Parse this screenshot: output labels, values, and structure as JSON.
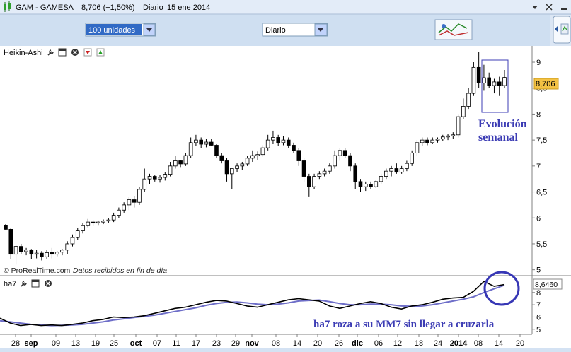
{
  "window": {
    "title": "GAM - GAMESA",
    "price": "8,706 (+1,50%)",
    "period": "Diario",
    "date": "15 ene 2014"
  },
  "toolbar": {
    "units_value": "100 unidades",
    "interval_value": "Diario"
  },
  "price_panel": {
    "indicator_name": "Heikin-Ashi",
    "last_value_label": "8,706",
    "copyright": "© ProRealTime.com",
    "data_note": "Datos recibidos en fin de día",
    "annotation_line1": "Evolución",
    "annotation_line2": "semanal"
  },
  "ha7_panel": {
    "indicator_name": "ha7",
    "last_value_label": "8,6460",
    "annotation": "ha7 roza a su MM7 sin llegar a cruzarla"
  },
  "colors": {
    "accent": "#6e6ec8",
    "annotation_text": "#3c3cb4",
    "circle": "#3737b5",
    "last_price_bg": "#f4c244",
    "bull": "#ffffff",
    "bear": "#000000"
  },
  "chart_data": [
    {
      "type": "candlestick",
      "subtype": "heikin-ashi",
      "title": "GAM - GAMESA",
      "ylim": [
        4.9,
        9.3
      ],
      "y_ticks": [
        "5",
        "5,5",
        "6",
        "6,5",
        "7",
        "7,5",
        "8",
        "8,5",
        "9"
      ],
      "x_ticks": [
        "28",
        "sep",
        "09",
        "13",
        "19",
        "25",
        "oct",
        "07",
        "11",
        "17",
        "23",
        "29",
        "nov",
        "08",
        "14",
        "20",
        "26",
        "dic",
        "06",
        "12",
        "18",
        "24",
        "2014",
        "08",
        "14",
        "20"
      ],
      "last_value": 8.706,
      "candles": [
        {
          "o": 5.85,
          "h": 5.88,
          "l": 5.76,
          "c": 5.78
        },
        {
          "o": 5.78,
          "h": 5.8,
          "l": 5.2,
          "c": 5.3
        },
        {
          "o": 5.3,
          "h": 5.48,
          "l": 5.1,
          "c": 5.45
        },
        {
          "o": 5.45,
          "h": 5.5,
          "l": 5.3,
          "c": 5.35
        },
        {
          "o": 5.35,
          "h": 5.42,
          "l": 5.28,
          "c": 5.38
        },
        {
          "o": 5.38,
          "h": 5.4,
          "l": 5.2,
          "c": 5.3
        },
        {
          "o": 5.3,
          "h": 5.38,
          "l": 5.22,
          "c": 5.32
        },
        {
          "o": 5.32,
          "h": 5.36,
          "l": 5.18,
          "c": 5.25
        },
        {
          "o": 5.25,
          "h": 5.38,
          "l": 5.2,
          "c": 5.33
        },
        {
          "o": 5.33,
          "h": 5.42,
          "l": 5.22,
          "c": 5.3
        },
        {
          "o": 5.3,
          "h": 5.36,
          "l": 5.26,
          "c": 5.34
        },
        {
          "o": 5.34,
          "h": 5.4,
          "l": 5.28,
          "c": 5.38
        },
        {
          "o": 5.38,
          "h": 5.55,
          "l": 5.3,
          "c": 5.5
        },
        {
          "o": 5.5,
          "h": 5.68,
          "l": 5.45,
          "c": 5.62
        },
        {
          "o": 5.62,
          "h": 5.8,
          "l": 5.58,
          "c": 5.75
        },
        {
          "o": 5.75,
          "h": 5.9,
          "l": 5.7,
          "c": 5.85
        },
        {
          "o": 5.85,
          "h": 5.98,
          "l": 5.82,
          "c": 5.92
        },
        {
          "o": 5.92,
          "h": 5.96,
          "l": 5.84,
          "c": 5.9
        },
        {
          "o": 5.9,
          "h": 5.95,
          "l": 5.85,
          "c": 5.92
        },
        {
          "o": 5.92,
          "h": 5.97,
          "l": 5.88,
          "c": 5.94
        },
        {
          "o": 5.94,
          "h": 6.0,
          "l": 5.9,
          "c": 5.96
        },
        {
          "o": 5.96,
          "h": 6.1,
          "l": 5.92,
          "c": 6.05
        },
        {
          "o": 6.05,
          "h": 6.2,
          "l": 6.0,
          "c": 6.15
        },
        {
          "o": 6.15,
          "h": 6.3,
          "l": 6.1,
          "c": 6.25
        },
        {
          "o": 6.25,
          "h": 6.4,
          "l": 6.15,
          "c": 6.35
        },
        {
          "o": 6.35,
          "h": 6.42,
          "l": 6.2,
          "c": 6.3
        },
        {
          "o": 6.3,
          "h": 6.6,
          "l": 6.25,
          "c": 6.55
        },
        {
          "o": 6.55,
          "h": 6.95,
          "l": 6.5,
          "c": 6.75
        },
        {
          "o": 6.75,
          "h": 6.85,
          "l": 6.65,
          "c": 6.8
        },
        {
          "o": 6.8,
          "h": 6.82,
          "l": 6.7,
          "c": 6.75
        },
        {
          "o": 6.75,
          "h": 6.83,
          "l": 6.68,
          "c": 6.78
        },
        {
          "o": 6.78,
          "h": 6.88,
          "l": 6.72,
          "c": 6.84
        },
        {
          "o": 6.84,
          "h": 7.08,
          "l": 6.8,
          "c": 7.0
        },
        {
          "o": 7.0,
          "h": 7.2,
          "l": 6.95,
          "c": 7.1
        },
        {
          "o": 7.1,
          "h": 7.12,
          "l": 6.98,
          "c": 7.04
        },
        {
          "o": 7.04,
          "h": 7.25,
          "l": 7.0,
          "c": 7.2
        },
        {
          "o": 7.2,
          "h": 7.55,
          "l": 7.15,
          "c": 7.45
        },
        {
          "o": 7.45,
          "h": 7.6,
          "l": 7.38,
          "c": 7.5
        },
        {
          "o": 7.5,
          "h": 7.55,
          "l": 7.35,
          "c": 7.42
        },
        {
          "o": 7.42,
          "h": 7.52,
          "l": 7.36,
          "c": 7.46
        },
        {
          "o": 7.46,
          "h": 7.52,
          "l": 7.38,
          "c": 7.4
        },
        {
          "o": 7.4,
          "h": 7.42,
          "l": 7.15,
          "c": 7.2
        },
        {
          "o": 7.2,
          "h": 7.25,
          "l": 7.05,
          "c": 7.1
        },
        {
          "o": 7.1,
          "h": 7.15,
          "l": 6.7,
          "c": 6.85
        },
        {
          "o": 6.85,
          "h": 6.92,
          "l": 6.55,
          "c": 6.95
        },
        {
          "o": 6.95,
          "h": 7.05,
          "l": 6.88,
          "c": 7.0
        },
        {
          "o": 7.0,
          "h": 7.08,
          "l": 6.92,
          "c": 7.04
        },
        {
          "o": 7.04,
          "h": 7.2,
          "l": 7.0,
          "c": 7.15
        },
        {
          "o": 7.15,
          "h": 7.3,
          "l": 7.08,
          "c": 7.2
        },
        {
          "o": 7.2,
          "h": 7.28,
          "l": 7.12,
          "c": 7.22
        },
        {
          "o": 7.22,
          "h": 7.4,
          "l": 7.18,
          "c": 7.35
        },
        {
          "o": 7.35,
          "h": 7.6,
          "l": 7.3,
          "c": 7.5
        },
        {
          "o": 7.5,
          "h": 7.68,
          "l": 7.42,
          "c": 7.55
        },
        {
          "o": 7.55,
          "h": 7.6,
          "l": 7.38,
          "c": 7.45
        },
        {
          "o": 7.45,
          "h": 7.58,
          "l": 7.4,
          "c": 7.5
        },
        {
          "o": 7.5,
          "h": 7.55,
          "l": 7.35,
          "c": 7.4
        },
        {
          "o": 7.4,
          "h": 7.45,
          "l": 7.25,
          "c": 7.3
        },
        {
          "o": 7.3,
          "h": 7.35,
          "l": 7.0,
          "c": 7.1
        },
        {
          "o": 7.1,
          "h": 7.15,
          "l": 6.7,
          "c": 6.8
        },
        {
          "o": 6.8,
          "h": 6.85,
          "l": 6.4,
          "c": 6.6
        },
        {
          "o": 6.6,
          "h": 6.85,
          "l": 6.55,
          "c": 6.8
        },
        {
          "o": 6.8,
          "h": 6.9,
          "l": 6.75,
          "c": 6.85
        },
        {
          "o": 6.85,
          "h": 6.95,
          "l": 6.8,
          "c": 6.9
        },
        {
          "o": 6.9,
          "h": 7.05,
          "l": 6.85,
          "c": 7.0
        },
        {
          "o": 7.0,
          "h": 7.3,
          "l": 6.95,
          "c": 7.2
        },
        {
          "o": 7.2,
          "h": 7.35,
          "l": 7.1,
          "c": 7.3
        },
        {
          "o": 7.3,
          "h": 7.35,
          "l": 7.15,
          "c": 7.2
        },
        {
          "o": 7.2,
          "h": 7.25,
          "l": 6.9,
          "c": 7.0
        },
        {
          "o": 7.0,
          "h": 7.05,
          "l": 6.55,
          "c": 6.7
        },
        {
          "o": 6.7,
          "h": 6.75,
          "l": 6.5,
          "c": 6.6
        },
        {
          "o": 6.6,
          "h": 6.7,
          "l": 6.52,
          "c": 6.65
        },
        {
          "o": 6.65,
          "h": 6.7,
          "l": 6.55,
          "c": 6.6
        },
        {
          "o": 6.6,
          "h": 6.72,
          "l": 6.58,
          "c": 6.7
        },
        {
          "o": 6.7,
          "h": 6.85,
          "l": 6.65,
          "c": 6.8
        },
        {
          "o": 6.8,
          "h": 6.95,
          "l": 6.75,
          "c": 6.9
        },
        {
          "o": 6.9,
          "h": 7.0,
          "l": 6.8,
          "c": 6.95
        },
        {
          "o": 6.95,
          "h": 7.05,
          "l": 6.85,
          "c": 6.88
        },
        {
          "o": 6.88,
          "h": 7.0,
          "l": 6.85,
          "c": 6.95
        },
        {
          "o": 6.95,
          "h": 7.1,
          "l": 6.9,
          "c": 7.05
        },
        {
          "o": 7.05,
          "h": 7.3,
          "l": 7.0,
          "c": 7.25
        },
        {
          "o": 7.25,
          "h": 7.5,
          "l": 7.2,
          "c": 7.45
        },
        {
          "o": 7.45,
          "h": 7.55,
          "l": 7.38,
          "c": 7.5
        },
        {
          "o": 7.5,
          "h": 7.55,
          "l": 7.4,
          "c": 7.45
        },
        {
          "o": 7.45,
          "h": 7.55,
          "l": 7.42,
          "c": 7.5
        },
        {
          "o": 7.5,
          "h": 7.55,
          "l": 7.45,
          "c": 7.52
        },
        {
          "o": 7.52,
          "h": 7.6,
          "l": 7.48,
          "c": 7.56
        },
        {
          "o": 7.56,
          "h": 7.62,
          "l": 7.5,
          "c": 7.58
        },
        {
          "o": 7.58,
          "h": 7.65,
          "l": 7.52,
          "c": 7.6
        },
        {
          "o": 7.6,
          "h": 8.0,
          "l": 7.55,
          "c": 7.95
        },
        {
          "o": 7.95,
          "h": 8.3,
          "l": 7.9,
          "c": 8.15
        },
        {
          "o": 8.15,
          "h": 8.5,
          "l": 8.1,
          "c": 8.4
        },
        {
          "o": 8.4,
          "h": 9.0,
          "l": 8.35,
          "c": 8.9
        },
        {
          "o": 8.9,
          "h": 9.2,
          "l": 8.5,
          "c": 8.6
        },
        {
          "o": 8.6,
          "h": 8.95,
          "l": 8.45,
          "c": 8.7
        },
        {
          "o": 8.7,
          "h": 8.8,
          "l": 8.5,
          "c": 8.55
        },
        {
          "o": 8.55,
          "h": 8.68,
          "l": 8.4,
          "c": 8.62
        },
        {
          "o": 8.62,
          "h": 8.72,
          "l": 8.35,
          "c": 8.55
        },
        {
          "o": 8.55,
          "h": 8.85,
          "l": 8.5,
          "c": 8.706
        }
      ]
    },
    {
      "type": "line",
      "title": "ha7",
      "ylim": [
        4.7,
        9.2
      ],
      "y_ticks": [
        "5",
        "6",
        "7",
        "8"
      ],
      "last_value": 8.646,
      "series": [
        {
          "name": "ha7",
          "color": "#000000",
          "values": [
            5.9,
            5.5,
            5.3,
            5.4,
            5.3,
            5.35,
            5.3,
            5.4,
            5.5,
            5.7,
            5.8,
            6.0,
            5.95,
            6.0,
            6.1,
            6.3,
            6.5,
            6.7,
            6.8,
            7.0,
            7.2,
            7.35,
            7.3,
            7.1,
            6.9,
            6.8,
            7.0,
            7.2,
            7.4,
            7.5,
            7.4,
            7.3,
            6.9,
            6.7,
            6.9,
            7.1,
            7.25,
            7.1,
            6.8,
            6.65,
            6.9,
            7.0,
            7.2,
            7.45,
            7.55,
            7.6,
            8.1,
            8.9,
            8.5,
            8.65
          ]
        },
        {
          "name": "MM7",
          "color": "#6e6ec8",
          "values": [
            5.7,
            5.6,
            5.5,
            5.4,
            5.35,
            5.3,
            5.32,
            5.35,
            5.4,
            5.5,
            5.6,
            5.75,
            5.85,
            5.95,
            6.05,
            6.15,
            6.3,
            6.45,
            6.6,
            6.75,
            6.95,
            7.1,
            7.2,
            7.22,
            7.15,
            7.05,
            7.0,
            7.05,
            7.15,
            7.3,
            7.35,
            7.38,
            7.25,
            7.1,
            7.0,
            7.0,
            7.05,
            7.05,
            7.0,
            6.9,
            6.88,
            6.9,
            7.0,
            7.15,
            7.3,
            7.45,
            7.65,
            8.0,
            8.3,
            8.6
          ]
        }
      ]
    }
  ]
}
